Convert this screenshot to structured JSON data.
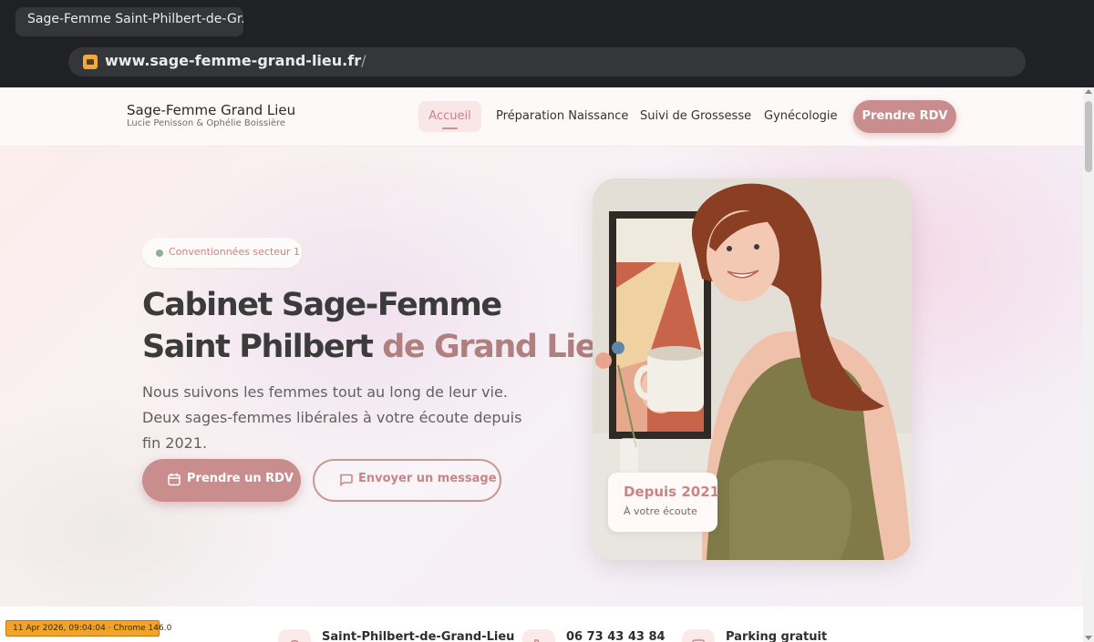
{
  "browser": {
    "tab_title": "Sage-Femme Saint-Philbert-de-Gr...",
    "url_domain": "www.sage-femme-grand-lieu.fr",
    "url_path": "/"
  },
  "header": {
    "brand_name": "Sage-Femme Grand Lieu",
    "brand_subtitle": "Lucie Penisson & Ophélie Boissière",
    "nav": [
      "Accueil",
      "Préparation Naissance",
      "Suivi de Grossesse",
      "Gynécologie"
    ],
    "cta_label": "Prendre RDV"
  },
  "hero": {
    "badge": "Conventionnées secteur 1",
    "title_line1": "Cabinet Sage-Femme",
    "title_line2_part1": "Saint Philbert ",
    "title_line2_accent": "de Grand Lieu",
    "description": "Nous suivons les femmes tout au long de leur vie. Deux sages-femmes libérales à votre écoute depuis fin 2021.",
    "primary_button": "Prendre un RDV",
    "secondary_button": "Envoyer un message",
    "photo_card_title": "Depuis 2021",
    "photo_card_subtitle": "À votre écoute"
  },
  "info": {
    "address": "Saint-Philbert-de-Grand-Lieu",
    "phone": "06 73 43 43 84",
    "parking": "Parking gratuit"
  },
  "stamp": "11 Apr 2026, 09:04:04 · Chrome 146.0",
  "colors": {
    "accent": "#c98d8d",
    "accent_text": "#c98585",
    "title": "#3b3b3b",
    "badge_dot": "#8fb28f"
  },
  "icons": {
    "calendar": "calendar-icon",
    "message": "message-icon",
    "location": "map-pin-icon",
    "phone": "phone-icon",
    "parking": "parking-icon"
  }
}
